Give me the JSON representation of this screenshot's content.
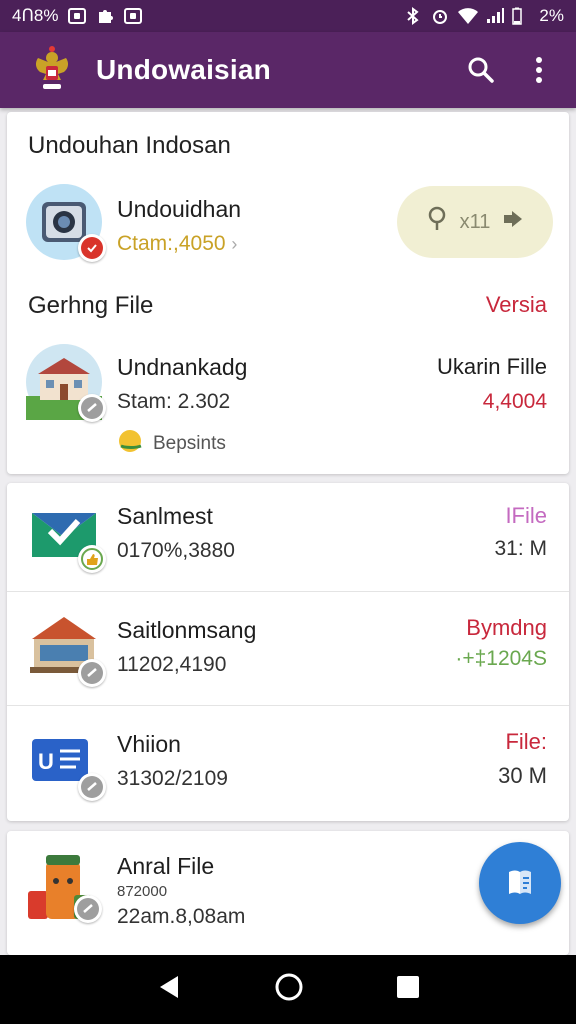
{
  "status_bar": {
    "time": "4Ո8%",
    "battery": "2%"
  },
  "app_bar": {
    "title": "Undowaisian",
    "logo_icon": "garuda-emblem-icon",
    "search_icon": "search-icon",
    "menu_icon": "more-vert-icon"
  },
  "card1": {
    "section_title": "Undouhan Indosan",
    "item1": {
      "title": "Undouidhan",
      "subtitle": "Ctam:,4050",
      "chevron": "›",
      "pill_text": "x11"
    },
    "section2_title": "Gerhng File",
    "section2_right": "Versia",
    "item2": {
      "title": "Undnankadg",
      "subtitle": "Stam: 2.302",
      "right_label": "Ukarin Fille",
      "right_value": "4,4004",
      "tag": "Bepsints"
    }
  },
  "card2": {
    "items": [
      {
        "title": "Sanlmest",
        "subtitle": "0170%,3880",
        "right_label": "IFile",
        "right_value": "31: M"
      },
      {
        "title": "Saitlonmsang",
        "subtitle": "11202,4190",
        "right_label": "Bymdng",
        "right_value": "·+‡1204S"
      },
      {
        "title": "Vhiion",
        "subtitle": "31302/2109",
        "right_label": "File:",
        "right_value": "30 M"
      }
    ]
  },
  "card3": {
    "title": "Anral File",
    "subtitle_small": "872000",
    "subtitle": "22am.8,08am"
  },
  "colors": {
    "status_bar": "#4b2058",
    "app_bar": "#5a2767",
    "accent_red": "#c8283c",
    "accent_green": "#6aa84f",
    "accent_pink": "#c46ac0",
    "fab": "#2f7fd6",
    "gold": "#c9a227"
  }
}
